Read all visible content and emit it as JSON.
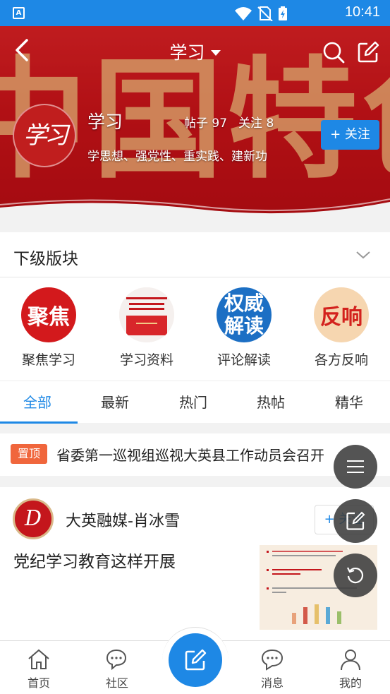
{
  "status_bar": {
    "time": "10:41",
    "app_badge": "A"
  },
  "header": {
    "title": "学习"
  },
  "banner": {
    "background_text": "中国特色"
  },
  "forum": {
    "logo_text": "学习",
    "name": "学习",
    "posts_label": "帖子 97",
    "follow_count_label": "关注 8",
    "description": "学思想、强党性、重实践、建新功",
    "follow_button": "+ 关注"
  },
  "sub_forums": {
    "title": "下级版块",
    "items": [
      {
        "icon_text": "聚焦",
        "label": "聚焦学习"
      },
      {
        "icon_text": "",
        "label": "学习资料"
      },
      {
        "icon_text": "权威解读",
        "label": "评论解读"
      },
      {
        "icon_text": "反响",
        "label": "各方反响"
      }
    ]
  },
  "tabs": [
    "全部",
    "最新",
    "热门",
    "热帖",
    "精华"
  ],
  "active_tab": "全部",
  "pinned": {
    "badge": "置顶",
    "title": "省委第一巡视组巡视大英县工作动员会召开"
  },
  "post": {
    "author": "大英融媒-肖冰雪",
    "follow_button": "+ 关注",
    "title": "党纪学习教育这样开展"
  },
  "bottom_nav": {
    "items": [
      {
        "label": "首页",
        "icon": "home-icon"
      },
      {
        "label": "社区",
        "icon": "chat-icon"
      },
      {
        "label": "",
        "icon": "compose-icon"
      },
      {
        "label": "消息",
        "icon": "message-icon"
      },
      {
        "label": "我的",
        "icon": "user-icon"
      }
    ]
  },
  "colors": {
    "primary": "#1e88e5",
    "banner_red": "#c4161c",
    "pin_badge": "#f0663c"
  }
}
